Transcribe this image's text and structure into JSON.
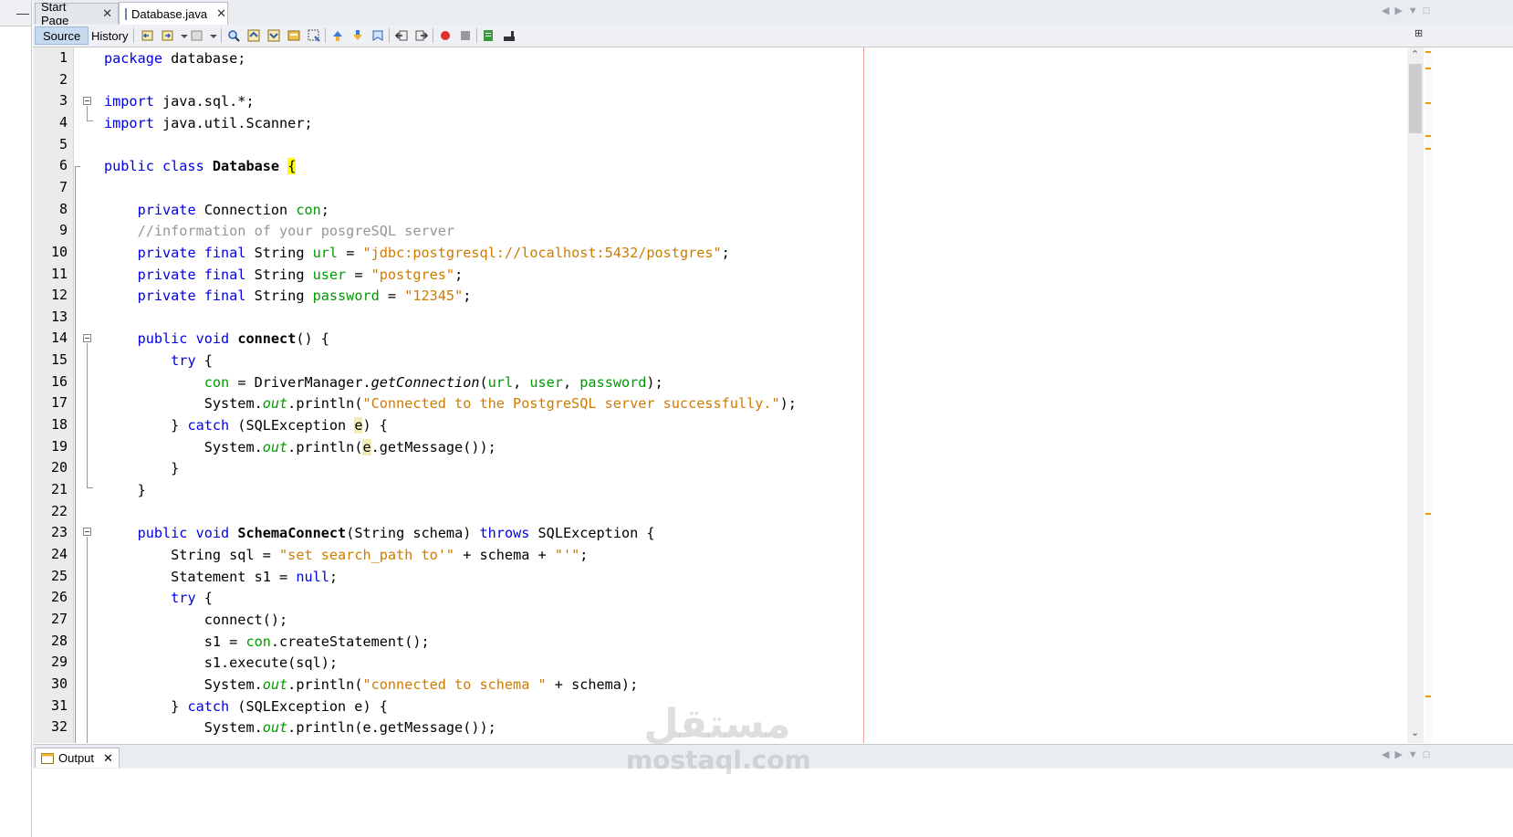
{
  "tabs": [
    {
      "label": "Start Page",
      "active": false
    },
    {
      "label": "Database.java",
      "active": true
    }
  ],
  "toolbar": {
    "source_label": "Source",
    "history_label": "History",
    "icons": [
      "back-icon",
      "forward-icon",
      "history-dropdown-icon",
      "find-icon",
      "find-previous-icon",
      "find-next-icon",
      "toggle-highlight-icon",
      "select-icon",
      "prev-bookmark-icon",
      "next-bookmark-icon",
      "toggle-bookmark-icon",
      "shift-left-icon",
      "shift-right-icon",
      "start-macro-icon",
      "stop-macro-icon",
      "comment-icon",
      "uncomment-icon"
    ]
  },
  "editor": {
    "line_numbers": [
      "1",
      "2",
      "3",
      "4",
      "5",
      "6",
      "7",
      "8",
      "9",
      "10",
      "11",
      "12",
      "13",
      "14",
      "15",
      "16",
      "17",
      "18",
      "19",
      "20",
      "21",
      "22",
      "23",
      "24",
      "25",
      "26",
      "27",
      "28",
      "29",
      "30",
      "31",
      "32"
    ],
    "lines": [
      [
        {
          "t": "package",
          "c": "kw"
        },
        {
          "t": " database;"
        }
      ],
      [],
      [
        {
          "t": "import",
          "c": "kw"
        },
        {
          "t": " java.sql.*;"
        }
      ],
      [
        {
          "t": "import",
          "c": "kw"
        },
        {
          "t": " java.util.Scanner;"
        }
      ],
      [],
      [
        {
          "t": "public class",
          "c": "kw"
        },
        {
          "t": " "
        },
        {
          "t": "Database",
          "c": "bold"
        },
        {
          "t": " "
        },
        {
          "t": "{",
          "c": "hlbrace"
        }
      ],
      [],
      [
        {
          "t": "    "
        },
        {
          "t": "private",
          "c": "kw"
        },
        {
          "t": " Connection "
        },
        {
          "t": "con",
          "c": "fld"
        },
        {
          "t": ";"
        }
      ],
      [
        {
          "t": "    "
        },
        {
          "t": "//information of your posgreSQL server",
          "c": "cmt"
        }
      ],
      [
        {
          "t": "    "
        },
        {
          "t": "private final",
          "c": "kw"
        },
        {
          "t": " String "
        },
        {
          "t": "url",
          "c": "fld"
        },
        {
          "t": " = "
        },
        {
          "t": "\"jdbc:postgresql://localhost:5432/postgres\"",
          "c": "str"
        },
        {
          "t": ";"
        }
      ],
      [
        {
          "t": "    "
        },
        {
          "t": "private final",
          "c": "kw"
        },
        {
          "t": " String "
        },
        {
          "t": "user",
          "c": "fld"
        },
        {
          "t": " = "
        },
        {
          "t": "\"postgres\"",
          "c": "str"
        },
        {
          "t": ";"
        }
      ],
      [
        {
          "t": "    "
        },
        {
          "t": "private final",
          "c": "kw"
        },
        {
          "t": " String "
        },
        {
          "t": "password",
          "c": "fld"
        },
        {
          "t": " = "
        },
        {
          "t": "\"12345\"",
          "c": "str"
        },
        {
          "t": ";"
        }
      ],
      [],
      [
        {
          "t": "    "
        },
        {
          "t": "public void",
          "c": "kw"
        },
        {
          "t": " "
        },
        {
          "t": "connect",
          "c": "bold"
        },
        {
          "t": "() {"
        }
      ],
      [
        {
          "t": "        "
        },
        {
          "t": "try",
          "c": "kw"
        },
        {
          "t": " {"
        }
      ],
      [
        {
          "t": "            "
        },
        {
          "t": "con",
          "c": "fld"
        },
        {
          "t": " = DriverManager."
        },
        {
          "t": "getConnection",
          "c": "it"
        },
        {
          "t": "("
        },
        {
          "t": "url",
          "c": "fld"
        },
        {
          "t": ", "
        },
        {
          "t": "user",
          "c": "fld"
        },
        {
          "t": ", "
        },
        {
          "t": "password",
          "c": "fld"
        },
        {
          "t": ");"
        }
      ],
      [
        {
          "t": "            System."
        },
        {
          "t": "out",
          "c": "itf"
        },
        {
          "t": ".println("
        },
        {
          "t": "\"Connected to the PostgreSQL server successfully.\"",
          "c": "str"
        },
        {
          "t": ");"
        }
      ],
      [
        {
          "t": "        } "
        },
        {
          "t": "catch",
          "c": "kw"
        },
        {
          "t": " (SQLException "
        },
        {
          "t": "e",
          "c": "hlvar"
        },
        {
          "t": ") {"
        }
      ],
      [
        {
          "t": "            System."
        },
        {
          "t": "out",
          "c": "itf"
        },
        {
          "t": ".println("
        },
        {
          "t": "e",
          "c": "hlvar"
        },
        {
          "t": ".getMessage());"
        }
      ],
      [
        {
          "t": "        }"
        }
      ],
      [
        {
          "t": "    }"
        }
      ],
      [],
      [
        {
          "t": "    "
        },
        {
          "t": "public void",
          "c": "kw"
        },
        {
          "t": " "
        },
        {
          "t": "SchemaConnect",
          "c": "bold"
        },
        {
          "t": "(String schema) "
        },
        {
          "t": "throws",
          "c": "kw"
        },
        {
          "t": " SQLException {"
        }
      ],
      [
        {
          "t": "        String sql = "
        },
        {
          "t": "\"set search_path to'\"",
          "c": "str"
        },
        {
          "t": " + schema + "
        },
        {
          "t": "\"'\"",
          "c": "str"
        },
        {
          "t": ";"
        }
      ],
      [
        {
          "t": "        Statement s1 = "
        },
        {
          "t": "null",
          "c": "kw"
        },
        {
          "t": ";"
        }
      ],
      [
        {
          "t": "        "
        },
        {
          "t": "try",
          "c": "kw"
        },
        {
          "t": " {"
        }
      ],
      [
        {
          "t": "            connect();"
        }
      ],
      [
        {
          "t": "            s1 = "
        },
        {
          "t": "con",
          "c": "fld"
        },
        {
          "t": ".createStatement();"
        }
      ],
      [
        {
          "t": "            s1.execute(sql);"
        }
      ],
      [
        {
          "t": "            System."
        },
        {
          "t": "out",
          "c": "itf"
        },
        {
          "t": ".println("
        },
        {
          "t": "\"connected to schema \"",
          "c": "str"
        },
        {
          "t": " + schema);"
        }
      ],
      [
        {
          "t": "        } "
        },
        {
          "t": "catch",
          "c": "kw"
        },
        {
          "t": " (SQLException e) {"
        }
      ],
      [
        {
          "t": "            System."
        },
        {
          "t": "out",
          "c": "itf"
        },
        {
          "t": ".println(e.getMessage());"
        }
      ]
    ]
  },
  "output": {
    "tab_label": "Output"
  },
  "watermark": {
    "arabic": "مستقل",
    "latin": "mostaql.com"
  },
  "colors": {
    "keyword": "#0000e6",
    "string": "#ce7b00",
    "comment": "#969696",
    "field": "#009900",
    "brace_highlight": "#ffff00",
    "margin_line": "#f2a0a0"
  }
}
